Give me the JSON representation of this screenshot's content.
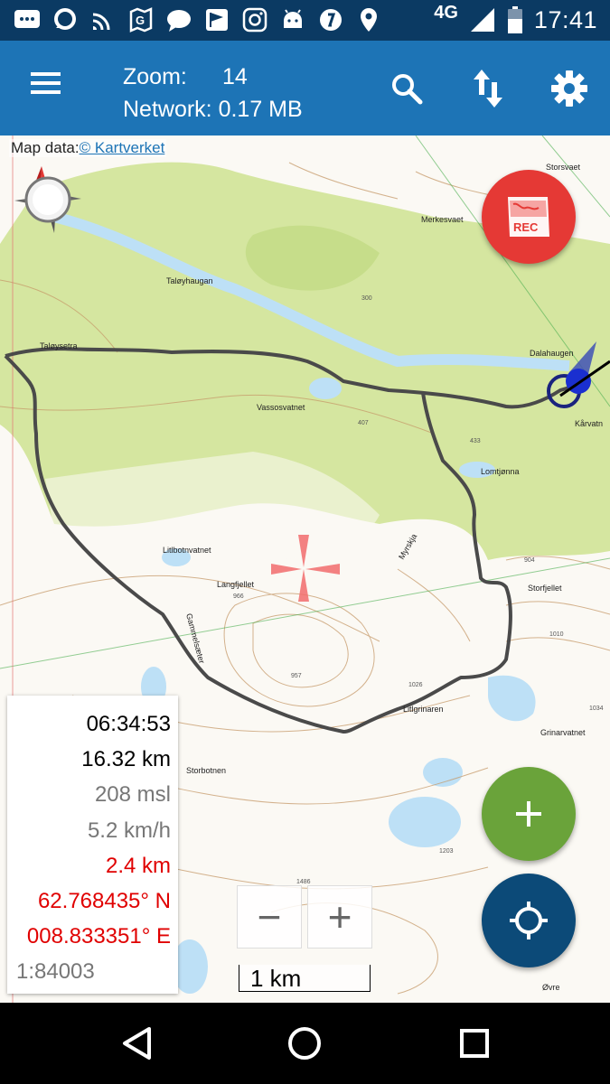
{
  "status_bar": {
    "time": "17:41",
    "network": "4G",
    "icons": [
      "messages-icon",
      "chat-bubble-icon",
      "wifi-call-icon",
      "maps-icon",
      "chat-icon",
      "flag-icon",
      "instagram-icon",
      "android-icon",
      "pokemon-icon",
      "location-icon",
      "signal-icon",
      "battery-icon"
    ]
  },
  "app_bar": {
    "zoom_label": "Zoom:",
    "zoom_value": "14",
    "network_label": "Network: 0.17 MB",
    "actions": [
      "menu-icon",
      "search-icon",
      "up-down-arrows-icon",
      "settings-gear-icon"
    ]
  },
  "map": {
    "attribution_prefix": "Map data:",
    "attribution_link": "© Kartverket",
    "place_labels": [
      "Taløyhaugan",
      "Taløysetra",
      "Vassosvatnet",
      "Merkesvaet",
      "Storsvaet",
      "Dalahaugen",
      "Kårvatn",
      "Lomtjønna",
      "Litlbotnvatnet",
      "Langfjellet",
      "Gammelsæter",
      "Storfjellet",
      "Litlgrinaren",
      "Storbotnen",
      "Grinarvatnet",
      "Myrskja",
      "Øvre"
    ],
    "elevation_labels": [
      "300",
      "407",
      "433",
      "966",
      "957",
      "1026",
      "904",
      "1010",
      "1034",
      "1203",
      "1486"
    ],
    "scale_label": "1 km",
    "colors": {
      "forest": "#d5e6a0",
      "open_land": "#fbf9f4",
      "water": "#bde0f6",
      "track": "#4a4a4a",
      "contour": "#c69a6a"
    }
  },
  "stats": {
    "time": "06:34:53",
    "distance": "16.32 km",
    "altitude": "208 msl",
    "speed": "5.2 km/h",
    "distance_to_target": "2.4 km",
    "latitude": "62.768435° N",
    "longitude": "008.833351° E",
    "scale": "1:84003"
  },
  "controls": {
    "zoom_out": "−",
    "zoom_in": "+",
    "rec_label": "REC"
  }
}
